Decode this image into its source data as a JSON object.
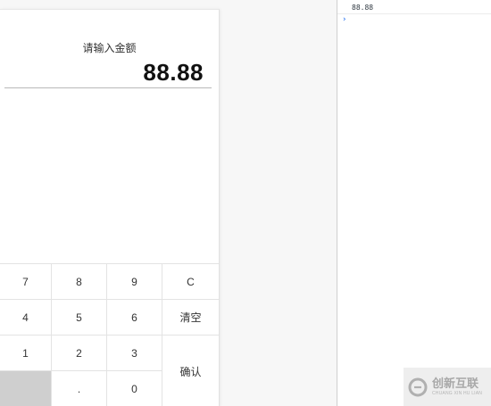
{
  "calculator": {
    "prompt": "请输入金额",
    "amount": "88.88"
  },
  "keypad": {
    "keys": {
      "k7": "7",
      "k8": "8",
      "k9": "9",
      "clear_one": "C",
      "k4": "4",
      "k5": "5",
      "k6": "6",
      "clear_all": "清空",
      "k1": "1",
      "k2": "2",
      "k3": "3",
      "confirm": "确认",
      "dot": ".",
      "k0": "0"
    },
    "blank_key_color": "#cfcfcf"
  },
  "console": {
    "log": "88.88",
    "prompt_symbol": "›",
    "prompt_color": "#367cf1"
  },
  "watermark": {
    "title": "创新互联",
    "subtitle": "CHUANG XIN HU LIAN"
  }
}
